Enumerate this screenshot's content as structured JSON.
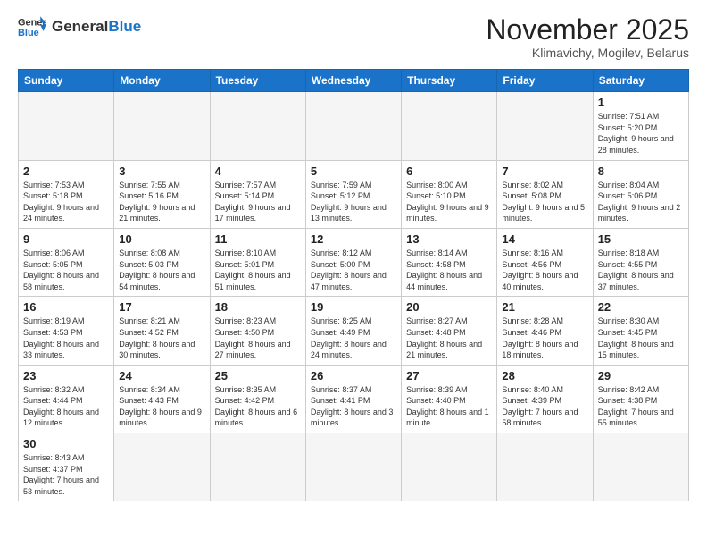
{
  "header": {
    "logo_general": "General",
    "logo_blue": "Blue",
    "month_title": "November 2025",
    "subtitle": "Klimavichy, Mogilev, Belarus"
  },
  "weekdays": [
    "Sunday",
    "Monday",
    "Tuesday",
    "Wednesday",
    "Thursday",
    "Friday",
    "Saturday"
  ],
  "weeks": [
    [
      {
        "day": "",
        "info": ""
      },
      {
        "day": "",
        "info": ""
      },
      {
        "day": "",
        "info": ""
      },
      {
        "day": "",
        "info": ""
      },
      {
        "day": "",
        "info": ""
      },
      {
        "day": "",
        "info": ""
      },
      {
        "day": "1",
        "info": "Sunrise: 7:51 AM\nSunset: 5:20 PM\nDaylight: 9 hours and 28 minutes."
      }
    ],
    [
      {
        "day": "2",
        "info": "Sunrise: 7:53 AM\nSunset: 5:18 PM\nDaylight: 9 hours and 24 minutes."
      },
      {
        "day": "3",
        "info": "Sunrise: 7:55 AM\nSunset: 5:16 PM\nDaylight: 9 hours and 21 minutes."
      },
      {
        "day": "4",
        "info": "Sunrise: 7:57 AM\nSunset: 5:14 PM\nDaylight: 9 hours and 17 minutes."
      },
      {
        "day": "5",
        "info": "Sunrise: 7:59 AM\nSunset: 5:12 PM\nDaylight: 9 hours and 13 minutes."
      },
      {
        "day": "6",
        "info": "Sunrise: 8:00 AM\nSunset: 5:10 PM\nDaylight: 9 hours and 9 minutes."
      },
      {
        "day": "7",
        "info": "Sunrise: 8:02 AM\nSunset: 5:08 PM\nDaylight: 9 hours and 5 minutes."
      },
      {
        "day": "8",
        "info": "Sunrise: 8:04 AM\nSunset: 5:06 PM\nDaylight: 9 hours and 2 minutes."
      }
    ],
    [
      {
        "day": "9",
        "info": "Sunrise: 8:06 AM\nSunset: 5:05 PM\nDaylight: 8 hours and 58 minutes."
      },
      {
        "day": "10",
        "info": "Sunrise: 8:08 AM\nSunset: 5:03 PM\nDaylight: 8 hours and 54 minutes."
      },
      {
        "day": "11",
        "info": "Sunrise: 8:10 AM\nSunset: 5:01 PM\nDaylight: 8 hours and 51 minutes."
      },
      {
        "day": "12",
        "info": "Sunrise: 8:12 AM\nSunset: 5:00 PM\nDaylight: 8 hours and 47 minutes."
      },
      {
        "day": "13",
        "info": "Sunrise: 8:14 AM\nSunset: 4:58 PM\nDaylight: 8 hours and 44 minutes."
      },
      {
        "day": "14",
        "info": "Sunrise: 8:16 AM\nSunset: 4:56 PM\nDaylight: 8 hours and 40 minutes."
      },
      {
        "day": "15",
        "info": "Sunrise: 8:18 AM\nSunset: 4:55 PM\nDaylight: 8 hours and 37 minutes."
      }
    ],
    [
      {
        "day": "16",
        "info": "Sunrise: 8:19 AM\nSunset: 4:53 PM\nDaylight: 8 hours and 33 minutes."
      },
      {
        "day": "17",
        "info": "Sunrise: 8:21 AM\nSunset: 4:52 PM\nDaylight: 8 hours and 30 minutes."
      },
      {
        "day": "18",
        "info": "Sunrise: 8:23 AM\nSunset: 4:50 PM\nDaylight: 8 hours and 27 minutes."
      },
      {
        "day": "19",
        "info": "Sunrise: 8:25 AM\nSunset: 4:49 PM\nDaylight: 8 hours and 24 minutes."
      },
      {
        "day": "20",
        "info": "Sunrise: 8:27 AM\nSunset: 4:48 PM\nDaylight: 8 hours and 21 minutes."
      },
      {
        "day": "21",
        "info": "Sunrise: 8:28 AM\nSunset: 4:46 PM\nDaylight: 8 hours and 18 minutes."
      },
      {
        "day": "22",
        "info": "Sunrise: 8:30 AM\nSunset: 4:45 PM\nDaylight: 8 hours and 15 minutes."
      }
    ],
    [
      {
        "day": "23",
        "info": "Sunrise: 8:32 AM\nSunset: 4:44 PM\nDaylight: 8 hours and 12 minutes."
      },
      {
        "day": "24",
        "info": "Sunrise: 8:34 AM\nSunset: 4:43 PM\nDaylight: 8 hours and 9 minutes."
      },
      {
        "day": "25",
        "info": "Sunrise: 8:35 AM\nSunset: 4:42 PM\nDaylight: 8 hours and 6 minutes."
      },
      {
        "day": "26",
        "info": "Sunrise: 8:37 AM\nSunset: 4:41 PM\nDaylight: 8 hours and 3 minutes."
      },
      {
        "day": "27",
        "info": "Sunrise: 8:39 AM\nSunset: 4:40 PM\nDaylight: 8 hours and 1 minute."
      },
      {
        "day": "28",
        "info": "Sunrise: 8:40 AM\nSunset: 4:39 PM\nDaylight: 7 hours and 58 minutes."
      },
      {
        "day": "29",
        "info": "Sunrise: 8:42 AM\nSunset: 4:38 PM\nDaylight: 7 hours and 55 minutes."
      }
    ],
    [
      {
        "day": "30",
        "info": "Sunrise: 8:43 AM\nSunset: 4:37 PM\nDaylight: 7 hours and 53 minutes."
      },
      {
        "day": "",
        "info": ""
      },
      {
        "day": "",
        "info": ""
      },
      {
        "day": "",
        "info": ""
      },
      {
        "day": "",
        "info": ""
      },
      {
        "day": "",
        "info": ""
      },
      {
        "day": "",
        "info": ""
      }
    ]
  ]
}
